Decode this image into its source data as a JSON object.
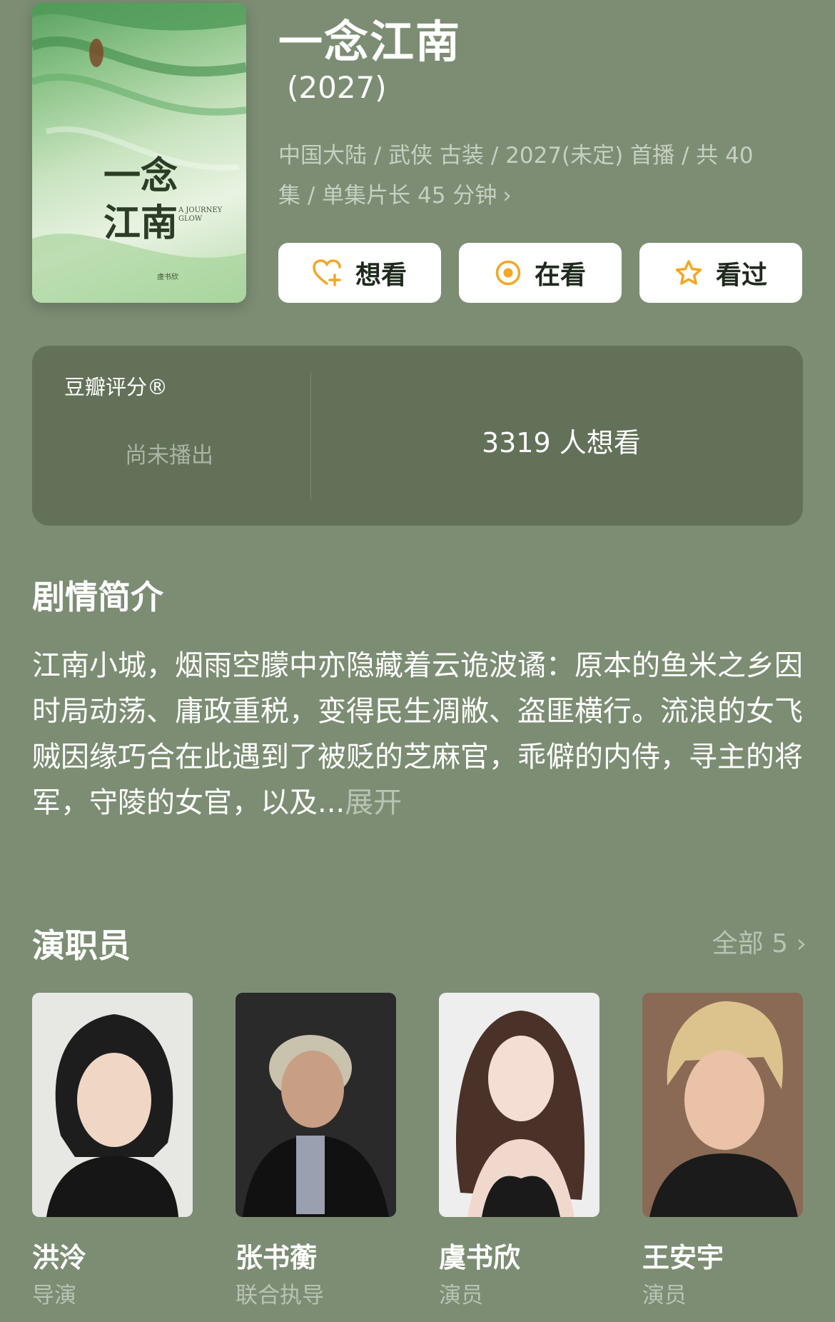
{
  "header": {
    "poster": {
      "title_art": "一念江南",
      "subtitle_art": "A JOURNEY GLOW",
      "credit_art": "虞书欣"
    },
    "title": "一念江南",
    "year": "(2027)",
    "meta_line1": "中国大陆 / 武侠 古装 / 2027(未定) 首播 / 共 40",
    "meta_line2": "集 / 单集片长 45 分钟"
  },
  "actions": {
    "want": "想看",
    "watching": "在看",
    "watched": "看过"
  },
  "rating": {
    "label": "豆瓣评分®",
    "status": "尚未播出",
    "want_count": "3319 人想看"
  },
  "synopsis": {
    "title": "剧情简介",
    "text": "江南小城，烟雨空朦中亦隐藏着云诡波谲：原本的鱼米之乡因时局动荡、庸政重税，变得民生凋敝、盗匪横行。流浪的女飞贼因缘巧合在此遇到了被贬的芝麻官，乖僻的内侍，寻主的将军，守陵的女官，以及...",
    "expand": "展开"
  },
  "cast": {
    "title": "演职员",
    "all": "全部 5",
    "items": [
      {
        "name": "洪泠",
        "role": "导演"
      },
      {
        "name": "张书蘅",
        "role": "联合执导"
      },
      {
        "name": "虞书欣",
        "role": "演员"
      },
      {
        "name": "王安宇",
        "role": "演员"
      }
    ]
  },
  "colors": {
    "background": "#7c8d73",
    "card": "#627158",
    "accent": "#f5a623"
  }
}
